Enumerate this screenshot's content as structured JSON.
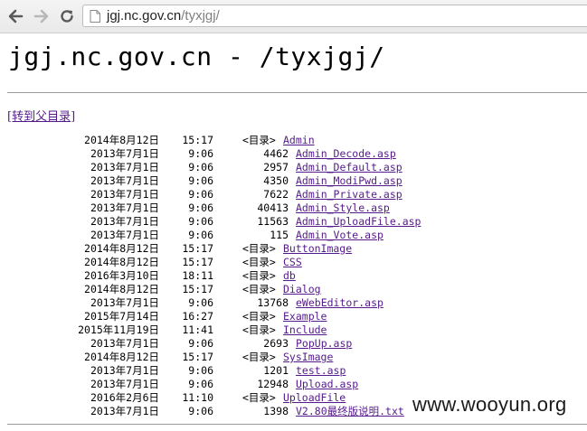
{
  "browser": {
    "url_host": "jgj.nc.gov.cn",
    "url_path": "/tyxjgj/"
  },
  "page": {
    "title": "jgj.nc.gov.cn - /tyxjgj/",
    "parent_link": "[转到父目录]",
    "dir_marker": "<目录>",
    "entries": [
      {
        "date": "2014年8月12日",
        "time": "15:17",
        "dir": true,
        "size": "",
        "name": "Admin"
      },
      {
        "date": "2013年7月1日",
        "time": "9:06",
        "dir": false,
        "size": "4462",
        "name": "Admin_Decode.asp"
      },
      {
        "date": "2013年7月1日",
        "time": "9:06",
        "dir": false,
        "size": "2957",
        "name": "Admin_Default.asp"
      },
      {
        "date": "2013年7月1日",
        "time": "9:06",
        "dir": false,
        "size": "4350",
        "name": "Admin_ModiPwd.asp"
      },
      {
        "date": "2013年7月1日",
        "time": "9:06",
        "dir": false,
        "size": "7622",
        "name": "Admin_Private.asp"
      },
      {
        "date": "2013年7月1日",
        "time": "9:06",
        "dir": false,
        "size": "40413",
        "name": "Admin_Style.asp"
      },
      {
        "date": "2013年7月1日",
        "time": "9:06",
        "dir": false,
        "size": "11563",
        "name": "Admin_UploadFile.asp"
      },
      {
        "date": "2013年7月1日",
        "time": "9:06",
        "dir": false,
        "size": "115",
        "name": "Admin_Vote.asp"
      },
      {
        "date": "2014年8月12日",
        "time": "15:17",
        "dir": true,
        "size": "",
        "name": "ButtonImage"
      },
      {
        "date": "2014年8月12日",
        "time": "15:17",
        "dir": true,
        "size": "",
        "name": "CSS"
      },
      {
        "date": "2016年3月10日",
        "time": "18:11",
        "dir": true,
        "size": "",
        "name": "db"
      },
      {
        "date": "2014年8月12日",
        "time": "15:17",
        "dir": true,
        "size": "",
        "name": "Dialog"
      },
      {
        "date": "2013年7月1日",
        "time": "9:06",
        "dir": false,
        "size": "13768",
        "name": "eWebEditor.asp"
      },
      {
        "date": "2015年7月14日",
        "time": "16:27",
        "dir": true,
        "size": "",
        "name": "Example"
      },
      {
        "date": "2015年11月19日",
        "time": "11:41",
        "dir": true,
        "size": "",
        "name": "Include"
      },
      {
        "date": "2013年7月1日",
        "time": "9:06",
        "dir": false,
        "size": "2693",
        "name": "PopUp.asp"
      },
      {
        "date": "2014年8月12日",
        "time": "15:17",
        "dir": true,
        "size": "",
        "name": "SysImage"
      },
      {
        "date": "2013年7月1日",
        "time": "9:06",
        "dir": false,
        "size": "1201",
        "name": "test.asp"
      },
      {
        "date": "2013年7月1日",
        "time": "9:06",
        "dir": false,
        "size": "12948",
        "name": "Upload.asp"
      },
      {
        "date": "2016年2月6日",
        "time": "11:10",
        "dir": true,
        "size": "",
        "name": "UploadFile"
      },
      {
        "date": "2013年7月1日",
        "time": "9:06",
        "dir": false,
        "size": "1398",
        "name": "V2.80最终版说明.txt"
      }
    ]
  },
  "watermark": "www.wooyun.org",
  "icons": {
    "back": "back-arrow-icon",
    "forward": "forward-arrow-icon",
    "reload": "reload-icon",
    "page": "page-icon"
  }
}
